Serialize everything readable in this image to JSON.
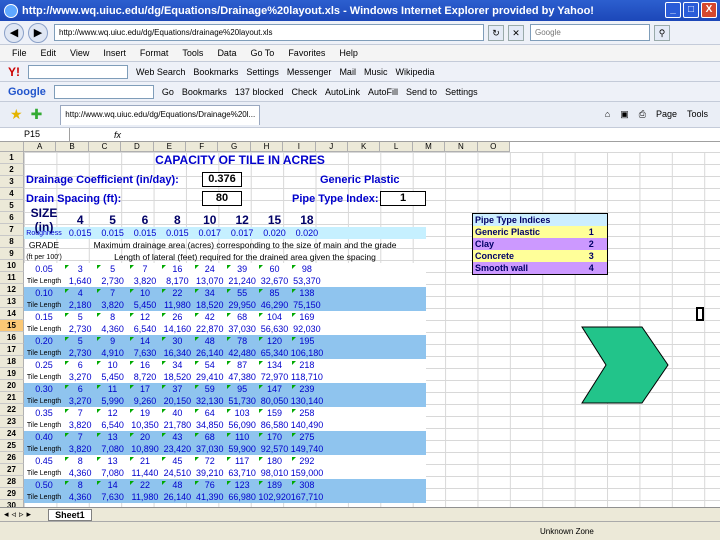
{
  "window": {
    "title": "http://www.wq.uiuc.edu/dg/Equations/Drainage%20layout.xls - Windows Internet Explorer provided by Yahoo!",
    "min": "_",
    "max": "□",
    "close": "X"
  },
  "address": {
    "url": "http://www.wq.uiuc.edu/dg/Equations/drainage%20layout.xls",
    "search_placeholder": "Google"
  },
  "menu": [
    "File",
    "Edit",
    "View",
    "Insert",
    "Format",
    "Tools",
    "Data",
    "Go To",
    "Favorites",
    "Help"
  ],
  "toolbar1": {
    "logo": "Y!",
    "web_search": "Web Search",
    "bookmarks": "Bookmarks",
    "settings": "Settings",
    "messenger": "Messenger",
    "mail": "Mail",
    "music": "Music",
    "wikipedia": "Wikipedia"
  },
  "toolbar2": {
    "logo": "Google",
    "go": "Go",
    "bookmarks": "Bookmarks",
    "blocked": "137 blocked",
    "check": "Check",
    "autolink": "AutoLink",
    "autofill": "AutoFill",
    "sendto": "Send to",
    "settings": "Settings"
  },
  "tabbar": {
    "tab_title": "http://www.wq.uiuc.edu/dg/Equations/Drainage%20l...",
    "page": "Page",
    "tools": "Tools"
  },
  "formula": {
    "cell": "P15",
    "fx": "fx"
  },
  "columns": [
    "A",
    "B",
    "C",
    "D",
    "E",
    "F",
    "G",
    "H",
    "I",
    "J",
    "K",
    "L",
    "M",
    "N",
    "O"
  ],
  "rows": [
    "1",
    "2",
    "3",
    "4",
    "5",
    "6",
    "7",
    "8",
    "9",
    "10",
    "11",
    "12",
    "13",
    "14",
    "15",
    "16",
    "17",
    "18",
    "19",
    "20",
    "21",
    "22",
    "23",
    "24",
    "25",
    "26",
    "27",
    "28",
    "29",
    "30"
  ],
  "selected_row": "15",
  "sheet": {
    "title": "CAPACITY OF TILE IN ACRES",
    "drainage_coefficient_label": "Drainage Coefficient (in/day):",
    "drainage_coefficient": "0.376",
    "pipe_name": "Generic Plastic",
    "drain_spacing_label": "Drain Spacing (ft):",
    "drain_spacing": "80",
    "pipe_type_label": "Pipe Type Index:",
    "pipe_type_index": "1",
    "size_label": "SIZE (in)",
    "sizes": [
      "4",
      "5",
      "6",
      "8",
      "10",
      "12",
      "15",
      "18"
    ],
    "roughness_label": "Roughness",
    "roughness": [
      "0.015",
      "0.015",
      "0.015",
      "0.015",
      "0.017",
      "0.017",
      "0.020",
      "0.020"
    ],
    "grade_label": "GRADE",
    "grade_header": "Maximum drainage area (acres) corresponding to the size of main and the grade",
    "grade_unit": "(ft per 100')",
    "lateral_header": "Length of lateral (feet) required for the drained area given the spacing",
    "tile_length_label": "Tile Length",
    "data": [
      {
        "grade": "0.05",
        "area": [
          "3",
          "5",
          "7",
          "16",
          "24",
          "39",
          "60",
          "98"
        ],
        "length": [
          "1,640",
          "2,730",
          "3,820",
          "8,170",
          "13,070",
          "21,240",
          "32,670",
          "53,370"
        ]
      },
      {
        "grade": "0.10",
        "area": [
          "4",
          "7",
          "10",
          "22",
          "34",
          "55",
          "85",
          "138"
        ],
        "length": [
          "2,180",
          "3,820",
          "5,450",
          "11,980",
          "18,520",
          "29,950",
          "46,290",
          "75,150"
        ]
      },
      {
        "grade": "0.15",
        "area": [
          "5",
          "8",
          "12",
          "26",
          "42",
          "68",
          "104",
          "169"
        ],
        "length": [
          "2,730",
          "4,360",
          "6,540",
          "14,160",
          "22,870",
          "37,030",
          "56,630",
          "92,030"
        ]
      },
      {
        "grade": "0.20",
        "area": [
          "5",
          "9",
          "14",
          "30",
          "48",
          "78",
          "120",
          "195"
        ],
        "length": [
          "2,730",
          "4,910",
          "7,630",
          "16,340",
          "26,140",
          "42,480",
          "65,340",
          "106,180"
        ]
      },
      {
        "grade": "0.25",
        "area": [
          "6",
          "10",
          "16",
          "34",
          "54",
          "87",
          "134",
          "218"
        ],
        "length": [
          "3,270",
          "5,450",
          "8,720",
          "18,520",
          "29,410",
          "47,380",
          "72,970",
          "118,710"
        ]
      },
      {
        "grade": "0.30",
        "area": [
          "6",
          "11",
          "17",
          "37",
          "59",
          "95",
          "147",
          "239"
        ],
        "length": [
          "3,270",
          "5,990",
          "9,260",
          "20,150",
          "32,130",
          "51,730",
          "80,050",
          "130,140"
        ]
      },
      {
        "grade": "0.35",
        "area": [
          "7",
          "12",
          "19",
          "40",
          "64",
          "103",
          "159",
          "258"
        ],
        "length": [
          "3,820",
          "6,540",
          "10,350",
          "21,780",
          "34,850",
          "56,090",
          "86,580",
          "140,490"
        ]
      },
      {
        "grade": "0.40",
        "area": [
          "7",
          "13",
          "20",
          "43",
          "68",
          "110",
          "170",
          "275"
        ],
        "length": [
          "3,820",
          "7,080",
          "10,890",
          "23,420",
          "37,030",
          "59,900",
          "92,570",
          "149,740"
        ]
      },
      {
        "grade": "0.45",
        "area": [
          "8",
          "13",
          "21",
          "45",
          "72",
          "117",
          "180",
          "292"
        ],
        "length": [
          "4,360",
          "7,080",
          "11,440",
          "24,510",
          "39,210",
          "63,710",
          "98,010",
          "159,000"
        ]
      },
      {
        "grade": "0.50",
        "area": [
          "8",
          "14",
          "22",
          "48",
          "76",
          "123",
          "189",
          "308"
        ],
        "length": [
          "4,360",
          "7,630",
          "11,980",
          "26,140",
          "41,390",
          "66,980",
          "102,920",
          "167,710"
        ]
      }
    ],
    "pipe_table": {
      "title": "Pipe Type Indices",
      "items": [
        {
          "name": "Generic Plastic",
          "index": "1",
          "color": "#ffff99"
        },
        {
          "name": "Clay",
          "index": "2",
          "color": "#cc99ff"
        },
        {
          "name": "Concrete",
          "index": "3",
          "color": "#ffff99"
        },
        {
          "name": "Smooth wall",
          "index": "4",
          "color": "#cc99ff"
        }
      ]
    },
    "arrow_color": "#22c48a"
  },
  "sheet_tab": "Sheet1",
  "status": {
    "zone": "Unknown Zone"
  }
}
